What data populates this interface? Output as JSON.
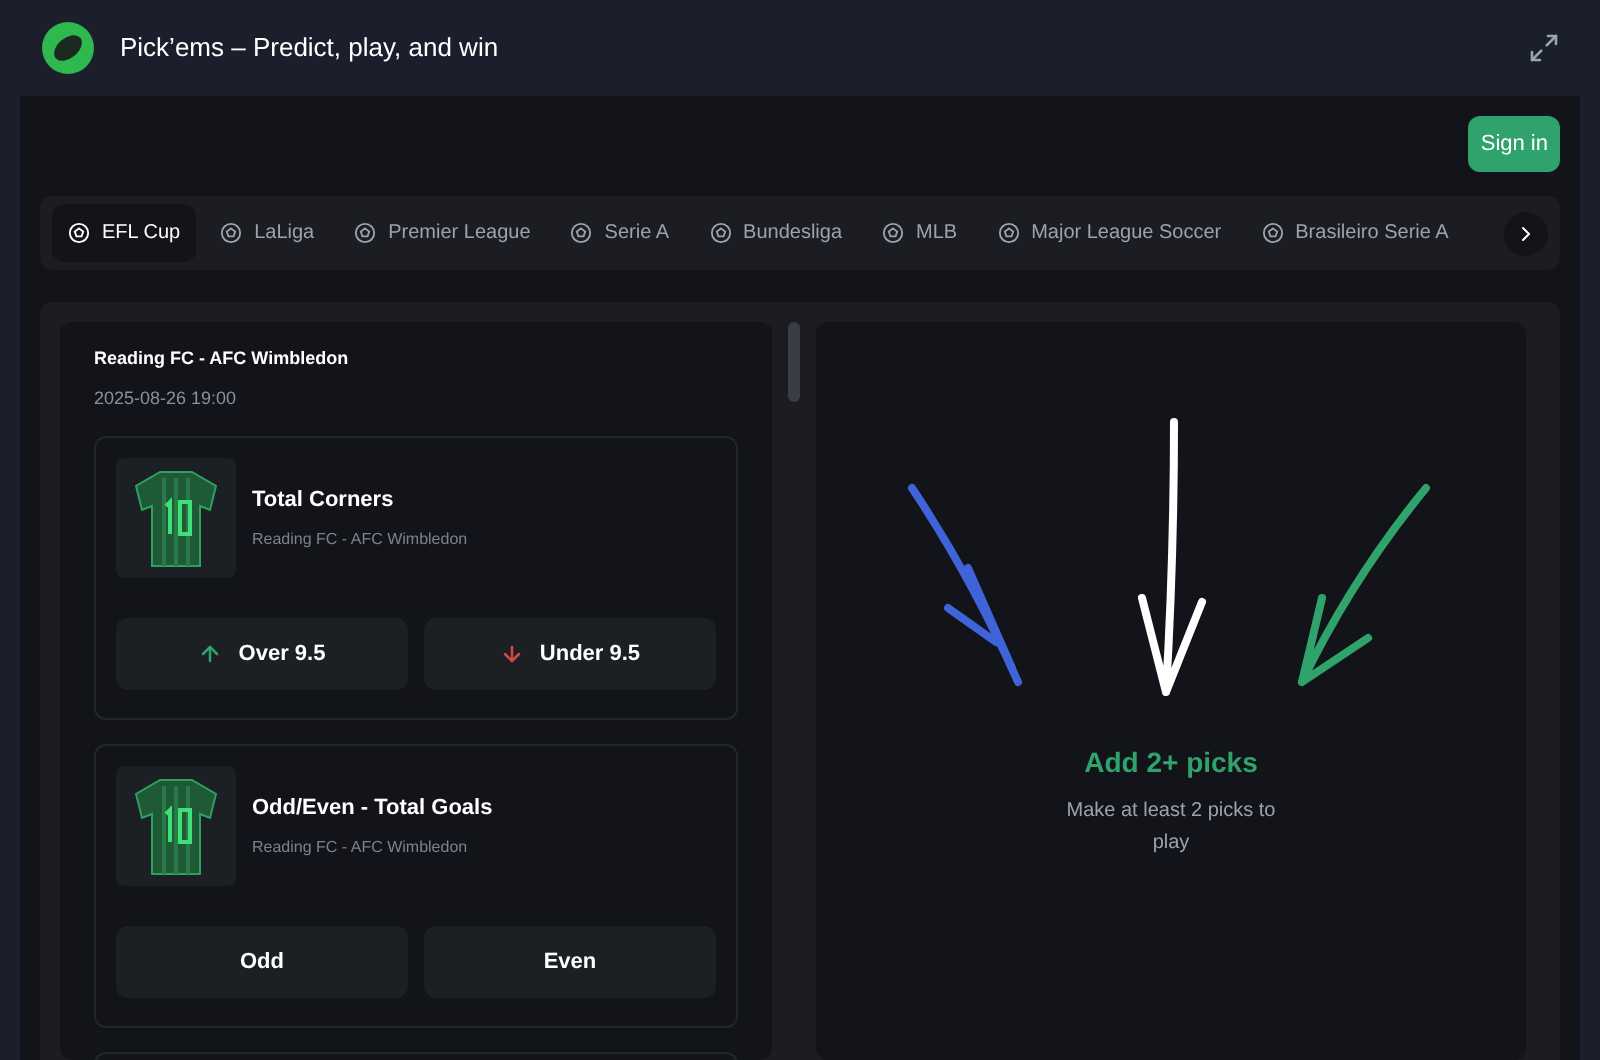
{
  "header": {
    "title": "Pick’ems – Predict, play, and win"
  },
  "sign_in": "Sign in",
  "tabs": [
    {
      "label": "EFL Cup",
      "selected": true
    },
    {
      "label": "LaLiga",
      "selected": false
    },
    {
      "label": "Premier League",
      "selected": false
    },
    {
      "label": "Serie A",
      "selected": false
    },
    {
      "label": "Bundesliga",
      "selected": false
    },
    {
      "label": "MLB",
      "selected": false
    },
    {
      "label": "Major League Soccer",
      "selected": false
    },
    {
      "label": "Brasileiro Serie A",
      "selected": false
    }
  ],
  "match": {
    "title": "Reading FC - AFC Wimbledon",
    "time": "2025-08-26 19:00"
  },
  "markets": [
    {
      "title": "Total Corners",
      "subtitle": "Reading FC - AFC Wimbledon",
      "options": [
        {
          "label": "Over 9.5",
          "kind": "up"
        },
        {
          "label": "Under 9.5",
          "kind": "down"
        }
      ]
    },
    {
      "title": "Odd/Even - Total Goals",
      "subtitle": "Reading FC - AFC Wimbledon",
      "options": [
        {
          "label": "Odd",
          "kind": "plain"
        },
        {
          "label": "Even",
          "kind": "plain"
        }
      ]
    }
  ],
  "empty_state": {
    "title": "Add 2+ picks",
    "text": "Make at least 2 picks to play"
  }
}
